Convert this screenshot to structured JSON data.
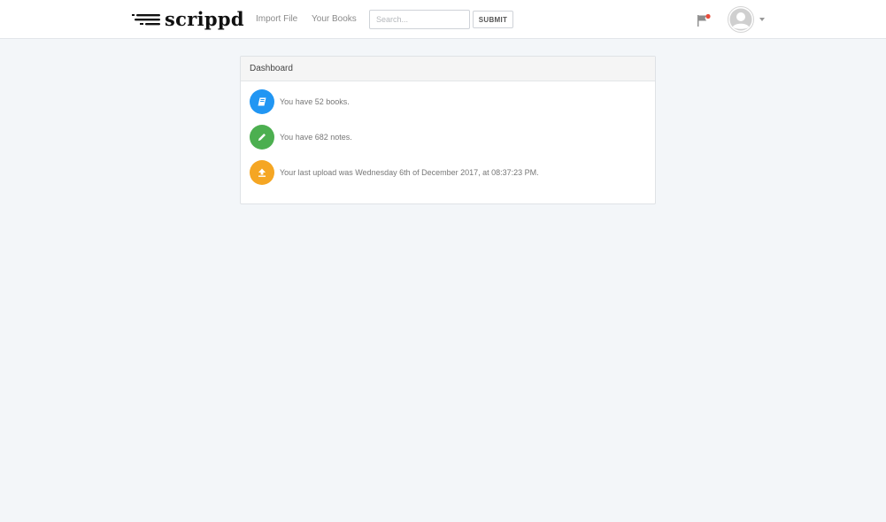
{
  "header": {
    "brand": "scrippd",
    "nav": [
      {
        "label": "Import File"
      },
      {
        "label": "Your Books"
      }
    ],
    "search": {
      "placeholder": "Search...",
      "value": ""
    },
    "submit_label": "SUBMIT",
    "notification_dot_color": "#e74c3c"
  },
  "dashboard": {
    "title": "Dashboard",
    "items": [
      {
        "icon": "book-icon",
        "color": "#2196f3",
        "text": "You have 52 books."
      },
      {
        "icon": "pencil-icon",
        "color": "#4caf50",
        "text": "You have 682 notes."
      },
      {
        "icon": "upload-icon",
        "color": "#f5a623",
        "text": "Your last upload was Wednesday 6th of December 2017, at 08:37:23 PM."
      }
    ]
  }
}
